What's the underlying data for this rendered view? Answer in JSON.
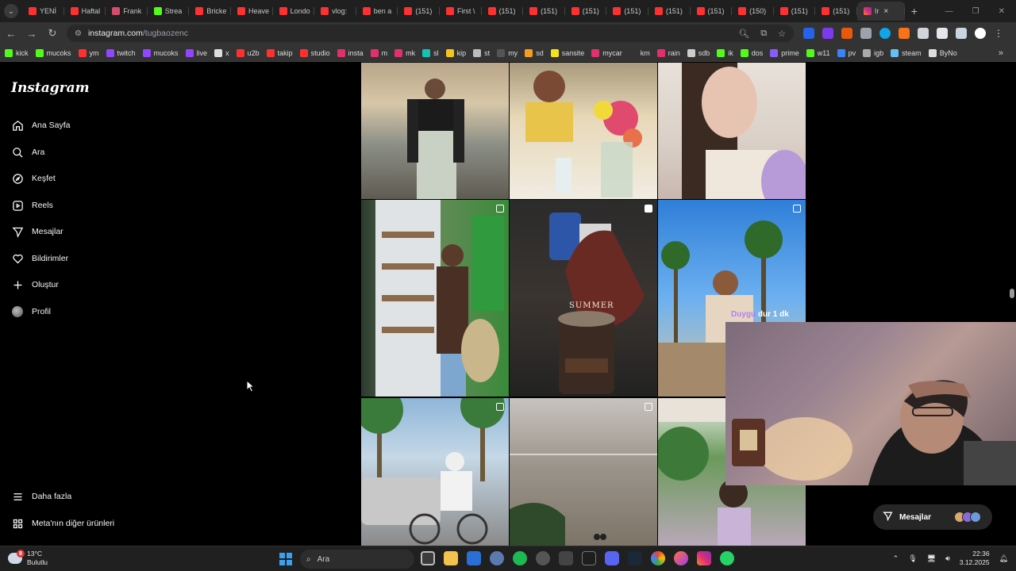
{
  "browser": {
    "tabs": [
      {
        "label": "YENİ",
        "color": "#ff3030"
      },
      {
        "label": "Haftal",
        "color": "#ff3030"
      },
      {
        "label": "Frank",
        "color": "#d84b6b"
      },
      {
        "label": "Strea",
        "color": "#53fc18"
      },
      {
        "label": "Bricke",
        "color": "#ff3030"
      },
      {
        "label": "Heave",
        "color": "#ff3030"
      },
      {
        "label": "Londo",
        "color": "#ff3030"
      },
      {
        "label": "vlog:",
        "color": "#ff3030"
      },
      {
        "label": "ben a",
        "color": "#ff3030"
      },
      {
        "label": "(151)",
        "color": "#ff3030"
      },
      {
        "label": "First \\",
        "color": "#ff3030"
      },
      {
        "label": "(151)",
        "color": "#ff3030"
      },
      {
        "label": "(151)",
        "color": "#ff3030"
      },
      {
        "label": "(151)",
        "color": "#ff3030"
      },
      {
        "label": "(151)",
        "color": "#ff3030"
      },
      {
        "label": "(151)",
        "color": "#ff3030"
      },
      {
        "label": "(151)",
        "color": "#ff3030"
      },
      {
        "label": "(150)",
        "color": "#ff3030"
      },
      {
        "label": "(151)",
        "color": "#ff3030"
      },
      {
        "label": "(151)",
        "color": "#ff3030"
      }
    ],
    "active_tab": {
      "label": "Ir",
      "close": "×"
    },
    "url_host": "instagram.com",
    "url_path": "/tugbaozenc",
    "bookmarks": [
      {
        "label": "kick",
        "color": "#53fc18"
      },
      {
        "label": "mucoks",
        "color": "#53fc18"
      },
      {
        "label": "ym",
        "color": "#ff3030"
      },
      {
        "label": "twitch",
        "color": "#9146ff"
      },
      {
        "label": "mucoks",
        "color": "#9146ff"
      },
      {
        "label": "live",
        "color": "#9146ff"
      },
      {
        "label": "x",
        "color": "#dddddd"
      },
      {
        "label": "u2b",
        "color": "#ff3030"
      },
      {
        "label": "takip",
        "color": "#ff3030"
      },
      {
        "label": "studio",
        "color": "#ff3030"
      },
      {
        "label": "insta",
        "color": "#e1306c"
      },
      {
        "label": "m",
        "color": "#e1306c"
      },
      {
        "label": "mk",
        "color": "#e1306c"
      },
      {
        "label": "sl",
        "color": "#16c2b3"
      },
      {
        "label": "kip",
        "color": "#f5c518"
      },
      {
        "label": "st",
        "color": "#bbbbbb"
      },
      {
        "label": "my",
        "color": "#555555"
      },
      {
        "label": "sd",
        "color": "#f59d1a"
      },
      {
        "label": "sansite",
        "color": "#f5e31a"
      },
      {
        "label": "mycar",
        "color": "#e1306c"
      },
      {
        "label": "km",
        "color": "#333333"
      },
      {
        "label": "rain",
        "color": "#e1306c"
      },
      {
        "label": "sdb",
        "color": "#cccccc"
      },
      {
        "label": "ik",
        "color": "#53fc18"
      },
      {
        "label": "dos",
        "color": "#53fc18"
      },
      {
        "label": "prime",
        "color": "#8a5cf6"
      },
      {
        "label": "w11",
        "color": "#53fc18"
      },
      {
        "label": "pv",
        "color": "#3b82f6"
      },
      {
        "label": "igb",
        "color": "#aaaaaa"
      },
      {
        "label": "steam",
        "color": "#66c0f4"
      },
      {
        "label": "ByNo",
        "color": "#dddddd"
      }
    ]
  },
  "sidebar": {
    "logo": "Instagram",
    "items": [
      {
        "label": "Ana Sayfa",
        "icon": "home-icon"
      },
      {
        "label": "Ara",
        "icon": "search-icon"
      },
      {
        "label": "Keşfet",
        "icon": "compass-icon"
      },
      {
        "label": "Reels",
        "icon": "reels-icon"
      },
      {
        "label": "Mesajlar",
        "icon": "send-icon"
      },
      {
        "label": "Bildirimler",
        "icon": "heart-icon"
      },
      {
        "label": "Oluştur",
        "icon": "plus-icon"
      },
      {
        "label": "Profil",
        "icon": "avatar"
      }
    ],
    "more": "Daha fazla",
    "meta": "Meta'nın diğer ürünleri"
  },
  "grid": {
    "summer_text": "SUMMER"
  },
  "overlay": {
    "chat_user": "Duygu",
    "chat_text": "dur 1 dk"
  },
  "messages_pill": {
    "label": "Mesajlar"
  },
  "taskbar": {
    "temp": "13°C",
    "weather": "Bulutlu",
    "weather_badge": "8",
    "search": "Ara",
    "time": "22:36",
    "date": "3.12.2025"
  }
}
